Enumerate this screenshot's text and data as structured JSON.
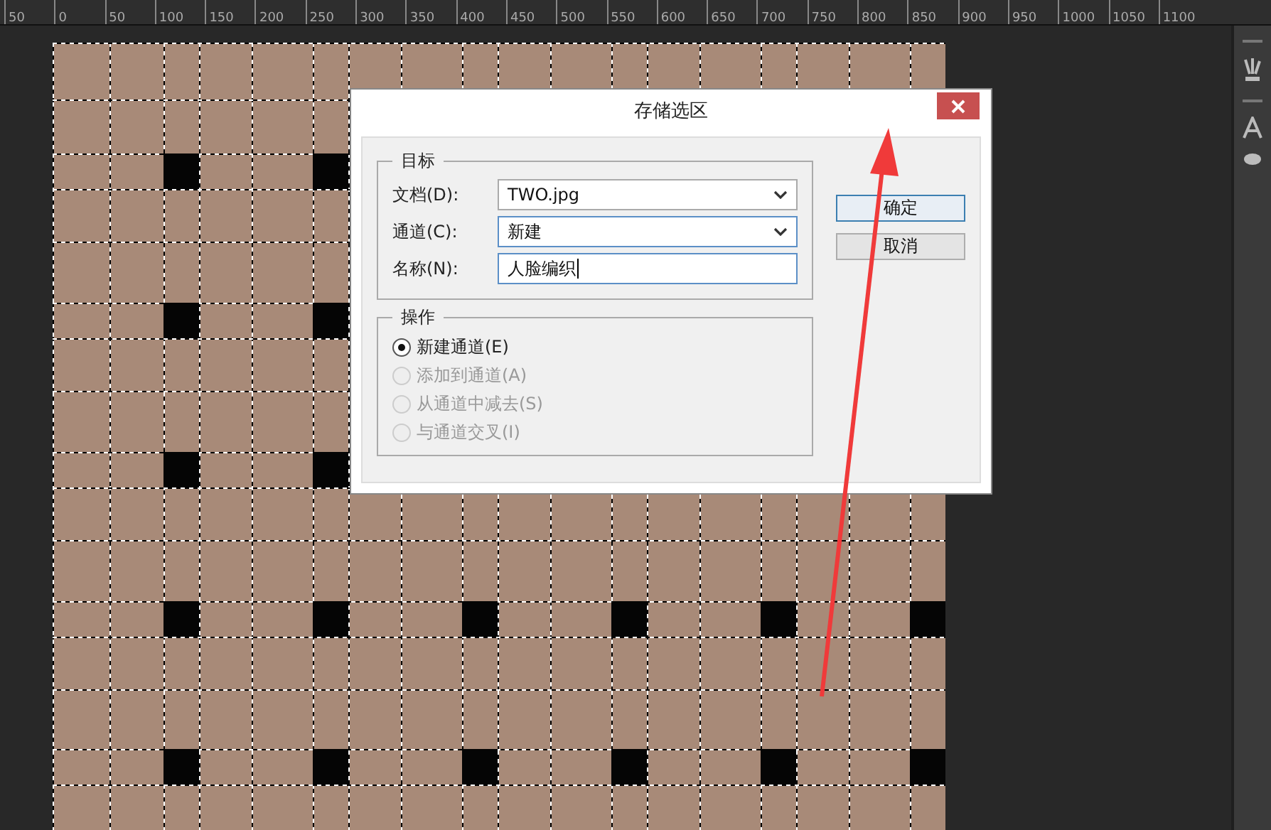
{
  "ruler": {
    "labels": [
      "50",
      "0",
      "50",
      "100",
      "150",
      "200",
      "250",
      "300",
      "350",
      "400",
      "450",
      "500",
      "550",
      "600",
      "650",
      "700",
      "750",
      "800",
      "850",
      "900",
      "950",
      "1000",
      "1050",
      "1100"
    ]
  },
  "dialog": {
    "title": "存储选区",
    "destination": {
      "legend": "目标",
      "fields": [
        {
          "label": "文档(D):",
          "kind": "select",
          "value": "TWO.jpg"
        },
        {
          "label": "通道(C):",
          "kind": "select",
          "value": "新建"
        },
        {
          "label": "名称(N):",
          "kind": "input",
          "value": "人脸编织"
        }
      ]
    },
    "operation": {
      "legend": "操作",
      "options": [
        {
          "label": "新建通道(E)",
          "selected": true,
          "disabled": false
        },
        {
          "label": "添加到通道(A)",
          "selected": false,
          "disabled": true
        },
        {
          "label": "从通道中减去(S)",
          "selected": false,
          "disabled": true
        },
        {
          "label": "与通道交叉(I)",
          "selected": false,
          "disabled": true
        }
      ]
    },
    "buttons": [
      {
        "label": "确定",
        "default": true
      },
      {
        "label": "取消",
        "default": false
      }
    ]
  }
}
